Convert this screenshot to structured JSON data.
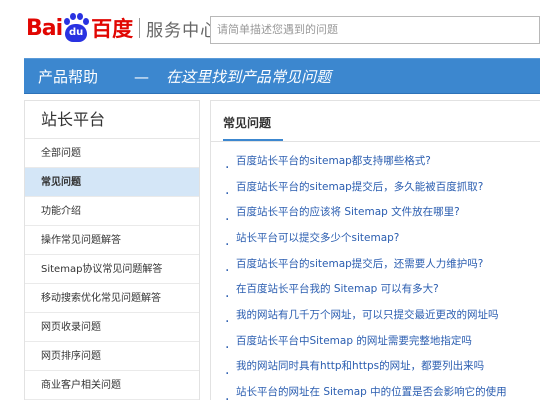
{
  "header": {
    "logo_bai": "Bai",
    "logo_du": "du",
    "logo_cn": "百度",
    "logo_sub": "服务中心",
    "search_placeholder": "请简单描述您遇到的问题"
  },
  "banner": {
    "title": "产品帮助",
    "dash": "—",
    "slogan": "在这里找到产品常见问题"
  },
  "sidebar": {
    "title": "站长平台",
    "items": [
      {
        "label": "全部问题",
        "active": false
      },
      {
        "label": "常见问题",
        "active": true
      },
      {
        "label": "功能介绍",
        "active": false
      },
      {
        "label": "操作常见问题解答",
        "active": false
      },
      {
        "label": "Sitemap协议常见问题解答",
        "active": false
      },
      {
        "label": "移动搜索优化常见问题解答",
        "active": false
      },
      {
        "label": "网页收录问题",
        "active": false
      },
      {
        "label": "网页排序问题",
        "active": false
      },
      {
        "label": "商业客户相关问题",
        "active": false
      }
    ]
  },
  "main": {
    "title": "常见问题",
    "faqs": [
      "百度站长平台的sitemap都支持哪些格式?",
      "百度站长平台的sitemap提交后，多久能被百度抓取?",
      "百度站长平台的应该将 Sitemap 文件放在哪里?",
      "站长平台可以提交多少个sitemap?",
      "百度站长平台的sitemap提交后，还需要人力维护吗?",
      "在百度站长平台我的 Sitemap 可以有多大?",
      "我的网站有几千万个网址，可以只提交最近更改的网址吗",
      "百度站长平台中Sitemap 的网址需要完整地指定吗",
      "我的网站同时具有http和https的网址，都要列出来吗",
      "站长平台的网址在 Sitemap 中的位置是否会影响它的使用"
    ]
  },
  "colors": {
    "brand_red": "#e10602",
    "brand_blue": "#2932e1",
    "banner_blue": "#3c87cf",
    "link_blue": "#2a5db0",
    "active_bg": "#d4e6f7"
  }
}
